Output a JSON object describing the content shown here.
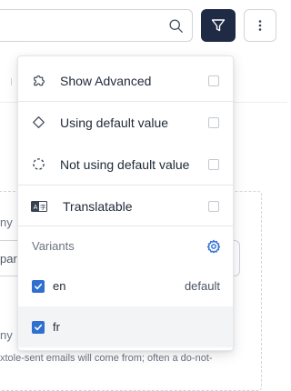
{
  "toolbar": {
    "search_icon": "search-icon",
    "filter_icon": "filter-icon",
    "more_icon": "more-vertical-icon",
    "filter_bg": "#1f2a44"
  },
  "background": {
    "label_fragment_1": "ny",
    "input_fragment": "par",
    "label_fragment_2": "ny",
    "help_fragment": "xtole-sent emails will come from; often a do-not-"
  },
  "menu": {
    "items": [
      {
        "label": "Show Advanced",
        "icon": "puzzle-icon",
        "checked": false
      },
      {
        "label": "Using default value",
        "icon": "diamond-icon",
        "checked": false
      },
      {
        "label": "Not using default value",
        "icon": "dashed-circle-icon",
        "checked": false
      },
      {
        "label": "Translatable",
        "icon": "translate-icon",
        "checked": false
      }
    ],
    "variants": {
      "title": "Variants",
      "settings_icon": "gear-icon",
      "items": [
        {
          "code": "en",
          "tag": "default",
          "checked": true
        },
        {
          "code": "fr",
          "tag": "",
          "checked": true
        }
      ]
    }
  },
  "colors": {
    "accent": "#2f6fd1",
    "checkbox_border": "#c4c8ce",
    "selected_row_bg": "#f3f4f6"
  }
}
